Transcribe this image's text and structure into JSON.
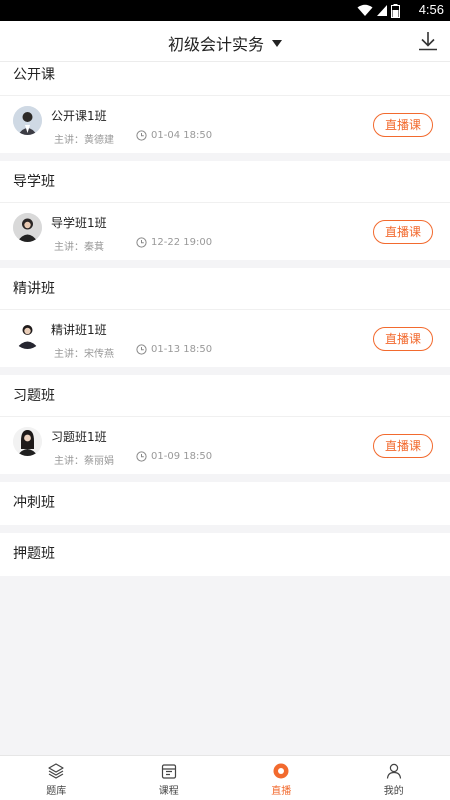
{
  "status": {
    "time": "4:56"
  },
  "header": {
    "title": "初级会计实务"
  },
  "sections": [
    {
      "title": "公开课",
      "course": {
        "name": "公开课1班",
        "teacher": "主讲：黄德建",
        "time": "01-04 18:50",
        "button": "直播课"
      }
    },
    {
      "title": "导学班",
      "course": {
        "name": "导学班1班",
        "teacher": "主讲：秦萁",
        "time": "12-22 19:00",
        "button": "直播课"
      }
    },
    {
      "title": "精讲班",
      "course": {
        "name": "精讲班1班",
        "teacher": "主讲：宋传燕",
        "time": "01-13 18:50",
        "button": "直播课"
      }
    },
    {
      "title": "习题班",
      "course": {
        "name": "习题班1班",
        "teacher": "主讲：蔡丽娟",
        "time": "01-09 18:50",
        "button": "直播课"
      }
    },
    {
      "title": "冲刺班"
    },
    {
      "title": "押题班"
    }
  ],
  "tabbar": [
    {
      "label": "题库",
      "icon": "layers-icon"
    },
    {
      "label": "课程",
      "icon": "calendar-icon"
    },
    {
      "label": "直播",
      "icon": "live-icon"
    },
    {
      "label": "我的",
      "icon": "user-icon"
    }
  ],
  "colors": {
    "accent": "#f26a2e",
    "background": "#f4f4f6"
  }
}
